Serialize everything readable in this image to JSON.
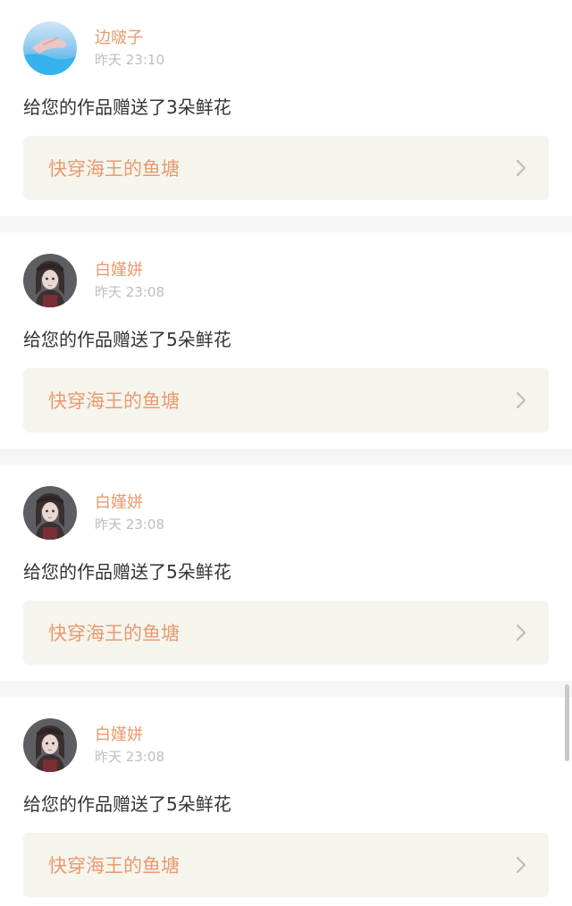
{
  "notifications": [
    {
      "username": "边啵子",
      "time": "昨天 23:10",
      "message": "给您的作品赠送了3朵鲜花",
      "work_title": "快穿海王的鱼塘",
      "avatar": "avatar-water-hand-icon"
    },
    {
      "username": "白嫤姘",
      "time": "昨天 23:08",
      "message": "给您的作品赠送了5朵鲜花",
      "work_title": "快穿海王的鱼塘",
      "avatar": "avatar-girl-portrait-icon"
    },
    {
      "username": "白嫤姘",
      "time": "昨天 23:08",
      "message": "给您的作品赠送了5朵鲜花",
      "work_title": "快穿海王的鱼塘",
      "avatar": "avatar-girl-portrait-icon"
    },
    {
      "username": "白嫤姘",
      "time": "昨天 23:08",
      "message": "给您的作品赠送了5朵鲜花",
      "work_title": "快穿海王的鱼塘",
      "avatar": "avatar-girl-portrait-icon"
    }
  ],
  "colors": {
    "accent": "#e99a6e",
    "link_bg": "#f5f5ee",
    "divider": "#f5f5f5"
  }
}
